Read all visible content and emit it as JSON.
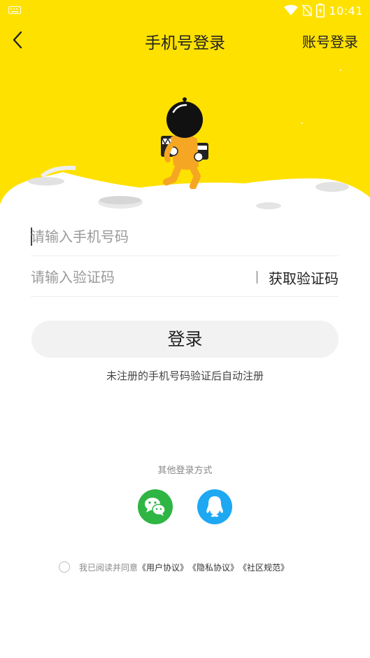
{
  "status_bar": {
    "time": "10:41",
    "icons": [
      "keyboard-icon",
      "wifi-icon",
      "no-sim-icon",
      "battery-charging-icon"
    ]
  },
  "nav": {
    "back_icon": "chevron-left-icon",
    "title": "手机号登录",
    "right_label": "账号登录"
  },
  "hero": {
    "illustration": "astronaut-on-moon",
    "background_color": "#FFE100"
  },
  "form": {
    "phone_placeholder": "请输入手机号码",
    "code_placeholder": "请输入验证码",
    "get_code_label": "获取验证码",
    "login_label": "登录",
    "hint": "未注册的手机号码验证后自动注册"
  },
  "other_login": {
    "title": "其他登录方式",
    "methods": [
      {
        "name": "wechat",
        "icon": "wechat-icon",
        "color": "#2FB544"
      },
      {
        "name": "qq",
        "icon": "qq-icon",
        "color": "#1EA8F2"
      }
    ]
  },
  "agreement": {
    "prefix": "我已阅读并同意",
    "links": [
      "《用户协议》",
      "《隐私协议》",
      "《社区规范》"
    ]
  }
}
